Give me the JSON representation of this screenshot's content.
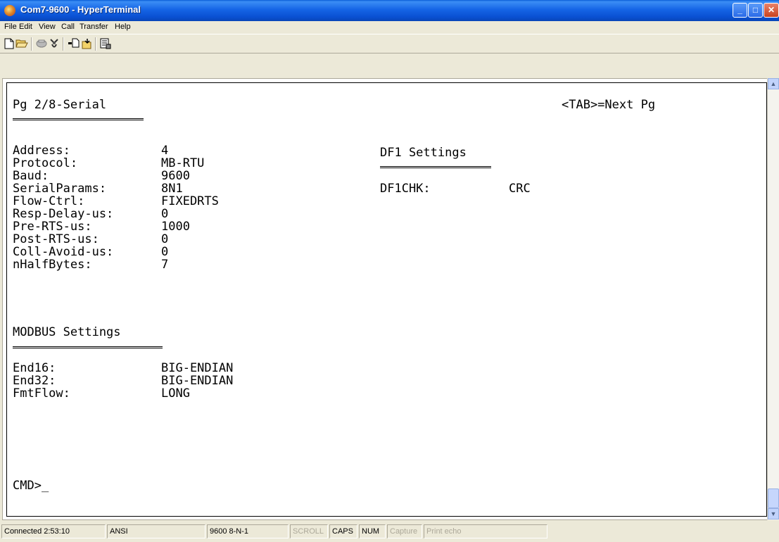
{
  "window": {
    "title": "Com7-9600 - HyperTerminal"
  },
  "menu": [
    "File",
    "Edit",
    "View",
    "Call",
    "Transfer",
    "Help"
  ],
  "toolbar": {
    "icons": [
      "new-connection-icon",
      "open-icon",
      "connect-icon",
      "disconnect-icon",
      "send-icon",
      "receive-icon",
      "properties-icon"
    ]
  },
  "terminal": {
    "page_label": "Pg 2/8-Serial",
    "next_hint": "<TAB>=Next Pg",
    "serial_rows": [
      {
        "label": "Address:",
        "value": "4"
      },
      {
        "label": "Protocol:",
        "value": "MB-RTU"
      },
      {
        "label": "Baud:",
        "value": "9600"
      },
      {
        "label": "SerialParams:",
        "value": "8N1"
      },
      {
        "label": "Flow-Ctrl:",
        "value": "FIXEDRTS"
      },
      {
        "label": "Resp-Delay-us:",
        "value": "0"
      },
      {
        "label": "Pre-RTS-us:",
        "value": "1000"
      },
      {
        "label": "Post-RTS-us:",
        "value": "0"
      },
      {
        "label": "Coll-Avoid-us:",
        "value": "0"
      },
      {
        "label": "nHalfBytes:",
        "value": "7"
      }
    ],
    "df1": {
      "heading": "DF1 Settings",
      "label": "DF1CHK:",
      "value": "CRC"
    },
    "modbus": {
      "heading": "MODBUS Settings",
      "rows": [
        {
          "label": "End16:",
          "value": "BIG-ENDIAN"
        },
        {
          "label": "End32:",
          "value": "BIG-ENDIAN"
        },
        {
          "label": "FmtFlow:",
          "value": "LONG"
        }
      ]
    },
    "prompt": "CMD>_"
  },
  "status": {
    "connected": "Connected 2:53:10",
    "emulation": "ANSI",
    "settings": "9600 8-N-1",
    "scroll": "SCROLL",
    "caps": "CAPS",
    "num": "NUM",
    "capture": "Capture",
    "print_echo": "Print echo"
  }
}
